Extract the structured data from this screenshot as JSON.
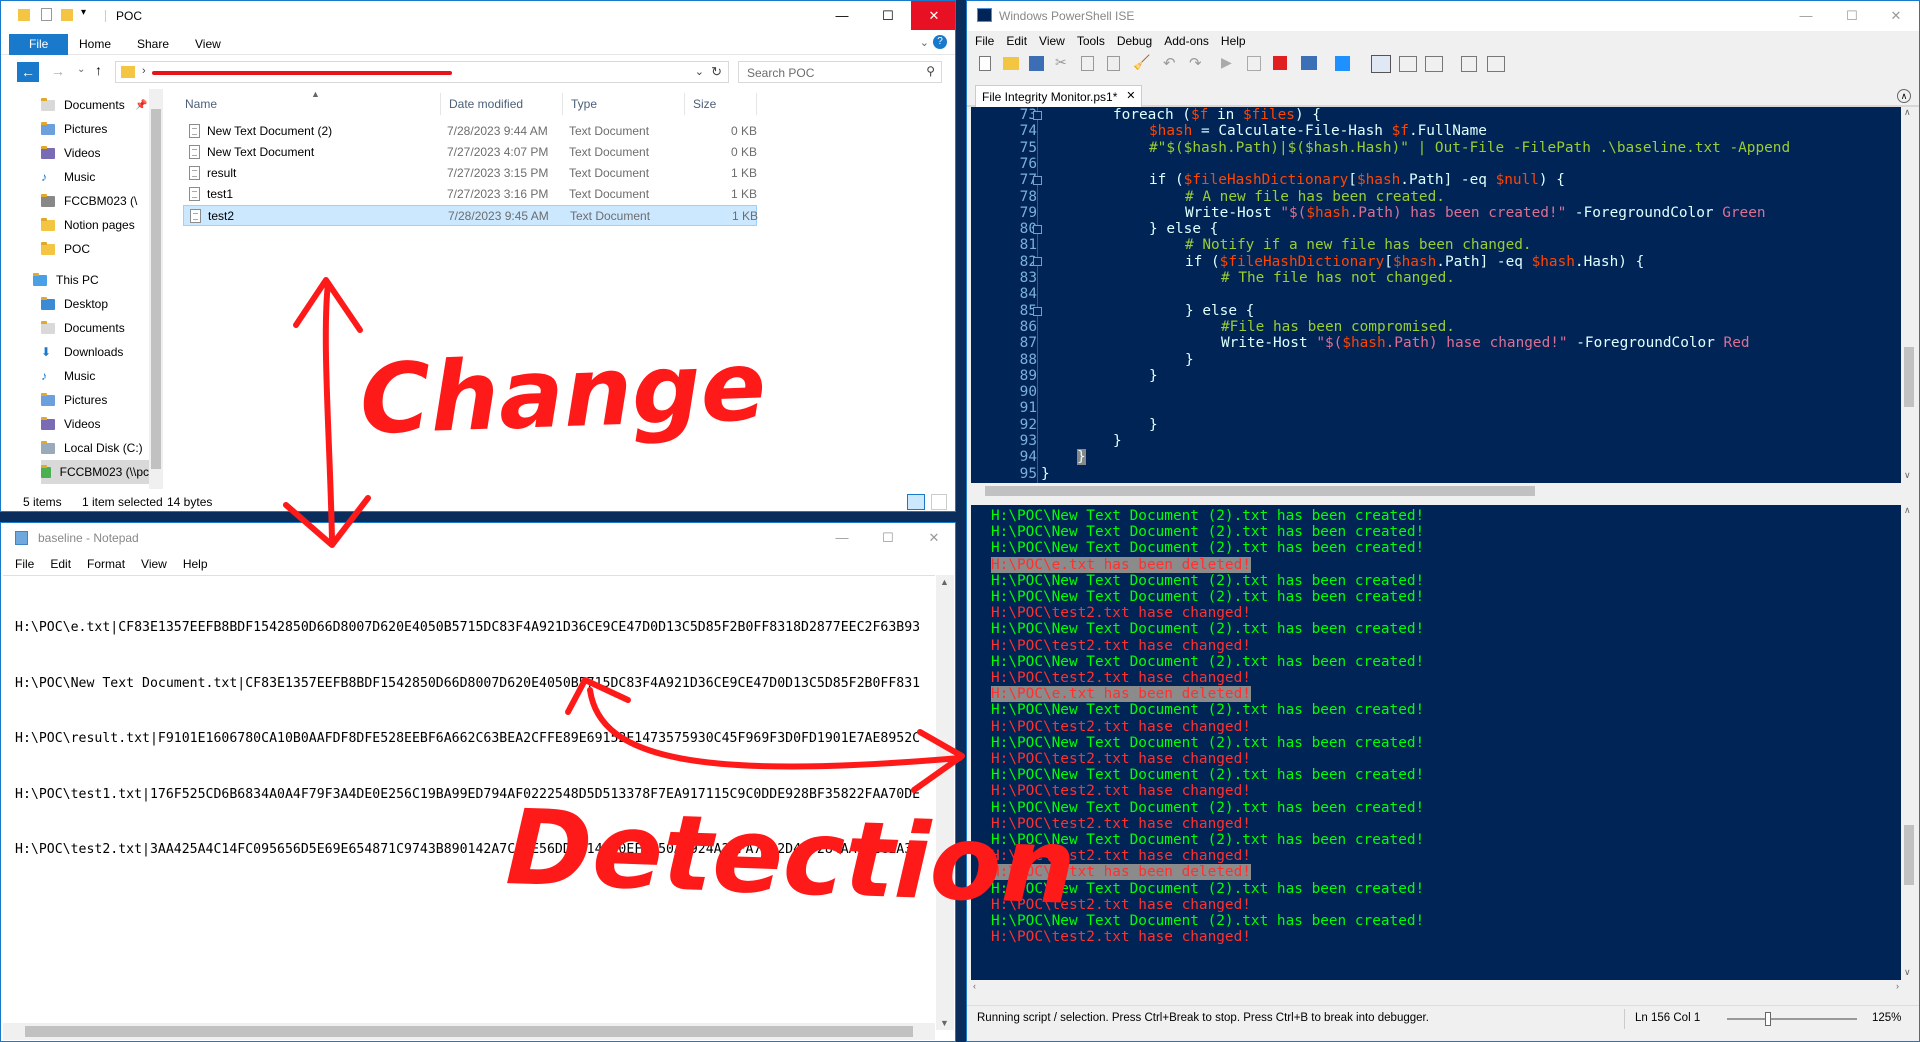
{
  "explorer": {
    "title": "POC",
    "ribbon_tabs": [
      "File",
      "Home",
      "Share",
      "View"
    ],
    "search_placeholder": "Search POC",
    "nav_items": [
      "Documents",
      "Pictures",
      "Videos",
      "Music",
      "FCCBM023 (\\",
      "Notion pages",
      "POC",
      "This PC",
      "Desktop",
      "Documents",
      "Downloads",
      "Music",
      "Pictures",
      "Videos",
      "Local Disk (C:)",
      "FCCBM023 (\\\\pc"
    ],
    "columns": [
      "Name",
      "Date modified",
      "Type",
      "Size"
    ],
    "files": [
      {
        "name": "New Text Document (2)",
        "date": "7/28/2023 9:44 AM",
        "type": "Text Document",
        "size": "0 KB"
      },
      {
        "name": "New Text Document",
        "date": "7/27/2023 4:07 PM",
        "type": "Text Document",
        "size": "0 KB"
      },
      {
        "name": "result",
        "date": "7/27/2023 3:15 PM",
        "type": "Text Document",
        "size": "1 KB"
      },
      {
        "name": "test1",
        "date": "7/27/2023 3:16 PM",
        "type": "Text Document",
        "size": "1 KB"
      },
      {
        "name": "test2",
        "date": "7/28/2023 9:45 AM",
        "type": "Text Document",
        "size": "1 KB"
      }
    ],
    "status_items": "5 items",
    "status_selected": "1 item selected",
    "status_size": "14 bytes"
  },
  "notepad": {
    "title": "baseline - Notepad",
    "menu": [
      "File",
      "Edit",
      "Format",
      "View",
      "Help"
    ],
    "lines": [
      "H:\\POC\\e.txt|CF83E1357EEFB8BDF1542850D66D8007D620E4050B5715DC83F4A921D36CE9CE47D0D13C5D85F2B0FF8318D2877EEC2F63B93",
      "H:\\POC\\New Text Document.txt|CF83E1357EEFB8BDF1542850D66D8007D620E4050B5715DC83F4A921D36CE9CE47D0D13C5D85F2B0FF831",
      "H:\\POC\\result.txt|F9101E1606780CA10B0AAFDF8DFE528EEBF6A662C63BEA2CFFE89E69152E1473575930C45F969F3D0FD1901E7AE8952C",
      "H:\\POC\\test1.txt|176F525CD6B6834A0A4F79F3A4DE0E256C19BA99ED794AF0222548D5D513378F7EA917115C9C0DDE928BF35822FAA70DE",
      "H:\\POC\\test2.txt|3AA425A4C14FC095656D5E69E654871C9743B890142A7C39E56DD3714AF0EF9650A2924A2DFA7C32D499284AA6A2CEA35"
    ]
  },
  "ise": {
    "title": "Windows PowerShell ISE",
    "menu": [
      "File",
      "Edit",
      "View",
      "Tools",
      "Debug",
      "Add-ons",
      "Help"
    ],
    "tab": "File Integrity Monitor.ps1*",
    "line_numbers": [
      "73",
      "74",
      "75",
      "76",
      "77",
      "78",
      "79",
      "80",
      "81",
      "82",
      "83",
      "84",
      "85",
      "86",
      "87",
      "88",
      "89",
      "90",
      "91",
      "92",
      "93",
      "94",
      "95"
    ],
    "status": "Running script / selection.  Press Ctrl+Break to stop.  Press Ctrl+B to break into debugger.",
    "position": "Ln 156  Col 1",
    "zoom": "125%",
    "output": {
      "created": "H:\\POC\\New Text Document (2).txt has been created!",
      "deleted": "H:\\POC\\e.txt has been deleted!",
      "changed": "H:\\POC\\test2.txt hase changed!"
    }
  },
  "annotations": {
    "change": "Change",
    "detection": "Detection"
  },
  "colors": {
    "ise_bg": "#012456",
    "accent": "#1979ca",
    "annotation": "#ff1a1a"
  }
}
